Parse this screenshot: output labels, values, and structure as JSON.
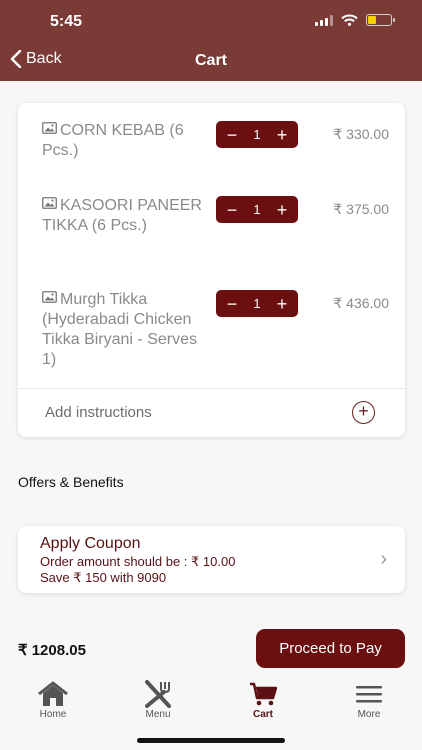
{
  "status_bar": {
    "time": "5:45"
  },
  "nav": {
    "back_label": "Back",
    "title": "Cart"
  },
  "cart": {
    "items": [
      {
        "name": "CORN KEBAB (6 Pcs.)",
        "quantity": "1",
        "price": "₹ 330.00"
      },
      {
        "name": "KASOORI PANEER TIKKA (6 Pcs.)",
        "quantity": "1",
        "price": "₹ 375.00"
      },
      {
        "name": "Murgh Tikka (Hyderabadi Chicken Tikka Biryani - Serves 1)",
        "quantity": "1",
        "price": "₹ 436.00"
      }
    ],
    "add_instructions": "Add instructions"
  },
  "offers": {
    "title": "Offers & Benefits",
    "coupon_title": "Apply Coupon",
    "coupon_line1": "Order amount should be : ₹ 10.00",
    "coupon_line2": "Save ₹ 150 with 9090"
  },
  "footer": {
    "total": "₹ 1208.05",
    "pay_label": "Proceed to Pay"
  },
  "tabs": [
    {
      "label": "Home",
      "icon": "home-icon"
    },
    {
      "label": "Menu",
      "icon": "cutlery-icon"
    },
    {
      "label": "Cart",
      "icon": "cart-icon",
      "active": true
    },
    {
      "label": "More",
      "icon": "menu-lines-icon"
    }
  ],
  "colors": {
    "brand": "#7a3a36",
    "accent": "#6b0f10",
    "coupon_text": "#5b1114",
    "battery": "#f4d000"
  }
}
